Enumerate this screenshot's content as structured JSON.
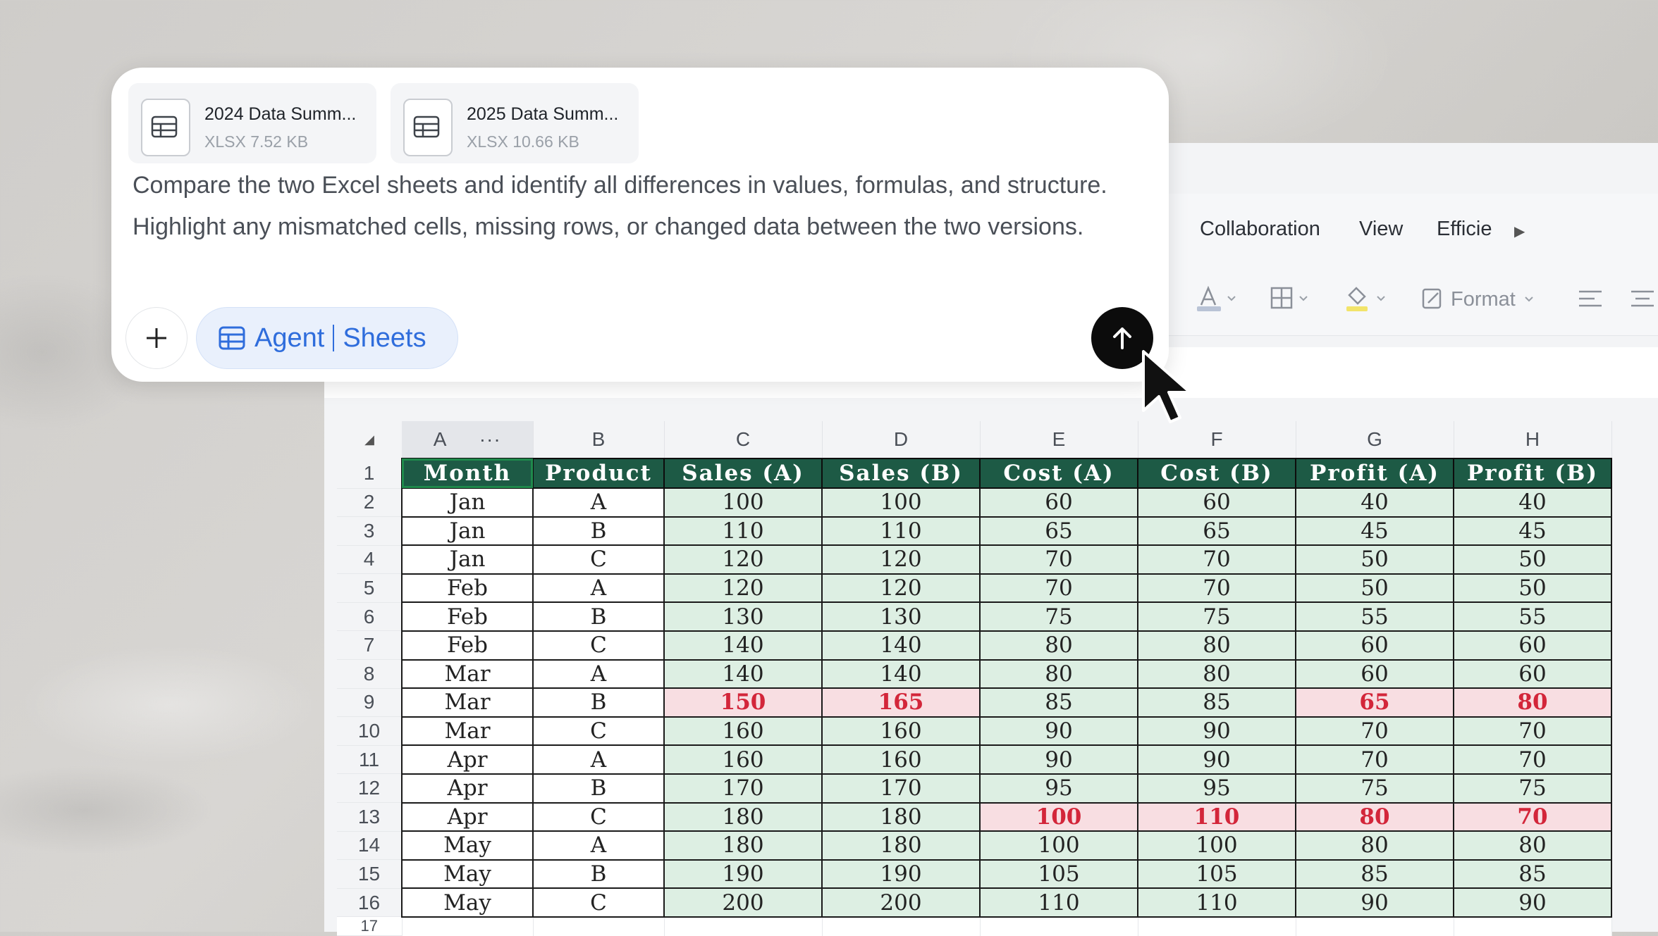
{
  "menu": {
    "items": [
      "Collaboration",
      "View",
      "Efficie"
    ]
  },
  "toolbar": {
    "format_label": "Format",
    "icons": [
      "font-color-icon",
      "borders-icon",
      "fill-color-icon",
      "format-painter-icon",
      "align-left-icon",
      "align-center-icon"
    ]
  },
  "chat": {
    "files": [
      {
        "name": "2024 Data Summ...",
        "meta": "XLSX 7.52 KB"
      },
      {
        "name": "2025 Data Summ...",
        "meta": "XLSX 10.66 KB"
      }
    ],
    "prompt": "Compare the two Excel sheets and identify all differences in values, formulas, and structure. Highlight any mismatched cells, missing rows, or changed data between the two versions.",
    "agent_label": "Agent",
    "mode_label": "Sheets"
  },
  "sheet": {
    "columns": [
      "A",
      "B",
      "C",
      "D",
      "E",
      "F",
      "G",
      "H"
    ],
    "column_menu": "···",
    "header_row_number": "1",
    "headers": [
      "Month",
      "Product",
      "Sales (A)",
      "Sales (B)",
      "Cost (A)",
      "Cost (B)",
      "Profit (A)",
      "Profit (B)"
    ],
    "rows": [
      {
        "n": "2",
        "cells": [
          "Jan",
          "A",
          "100",
          "100",
          "60",
          "60",
          "40",
          "40"
        ],
        "diff": []
      },
      {
        "n": "3",
        "cells": [
          "Jan",
          "B",
          "110",
          "110",
          "65",
          "65",
          "45",
          "45"
        ],
        "diff": []
      },
      {
        "n": "4",
        "cells": [
          "Jan",
          "C",
          "120",
          "120",
          "70",
          "70",
          "50",
          "50"
        ],
        "diff": []
      },
      {
        "n": "5",
        "cells": [
          "Feb",
          "A",
          "120",
          "120",
          "70",
          "70",
          "50",
          "50"
        ],
        "diff": []
      },
      {
        "n": "6",
        "cells": [
          "Feb",
          "B",
          "130",
          "130",
          "75",
          "75",
          "55",
          "55"
        ],
        "diff": []
      },
      {
        "n": "7",
        "cells": [
          "Feb",
          "C",
          "140",
          "140",
          "80",
          "80",
          "60",
          "60"
        ],
        "diff": []
      },
      {
        "n": "8",
        "cells": [
          "Mar",
          "A",
          "140",
          "140",
          "80",
          "80",
          "60",
          "60"
        ],
        "diff": []
      },
      {
        "n": "9",
        "cells": [
          "Mar",
          "B",
          "150",
          "165",
          "85",
          "85",
          "65",
          "80"
        ],
        "diff": [
          2,
          3,
          6,
          7
        ]
      },
      {
        "n": "10",
        "cells": [
          "Mar",
          "C",
          "160",
          "160",
          "90",
          "90",
          "70",
          "70"
        ],
        "diff": []
      },
      {
        "n": "11",
        "cells": [
          "Apr",
          "A",
          "160",
          "160",
          "90",
          "90",
          "70",
          "70"
        ],
        "diff": []
      },
      {
        "n": "12",
        "cells": [
          "Apr",
          "B",
          "170",
          "170",
          "95",
          "95",
          "75",
          "75"
        ],
        "diff": []
      },
      {
        "n": "13",
        "cells": [
          "Apr",
          "C",
          "180",
          "180",
          "100",
          "110",
          "80",
          "70"
        ],
        "diff": [
          4,
          5,
          6,
          7
        ]
      },
      {
        "n": "14",
        "cells": [
          "May",
          "A",
          "180",
          "180",
          "100",
          "100",
          "80",
          "80"
        ],
        "diff": []
      },
      {
        "n": "15",
        "cells": [
          "May",
          "B",
          "190",
          "190",
          "105",
          "105",
          "85",
          "85"
        ],
        "diff": []
      },
      {
        "n": "16",
        "cells": [
          "May",
          "C",
          "200",
          "200",
          "110",
          "110",
          "90",
          "90"
        ],
        "diff": []
      }
    ],
    "next_row_number": "17",
    "colors": {
      "header_bg": "#1d5a45",
      "data_green": "#ddefe3",
      "diff_bg": "#f8dee2",
      "diff_text": "#d3263a"
    }
  }
}
